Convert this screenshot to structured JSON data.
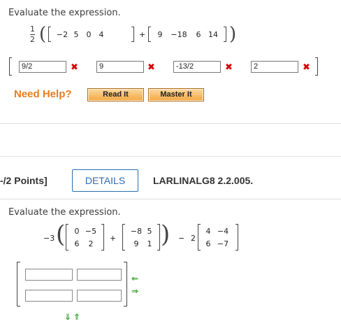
{
  "q1": {
    "prompt": "Evaluate the expression.",
    "fraction": {
      "num": "1",
      "den": "2"
    },
    "matrix_a": [
      "−2",
      "5",
      "0",
      "4"
    ],
    "plus": "+",
    "matrix_b": [
      "9",
      "−18",
      "6",
      "14"
    ],
    "answers": [
      "9/2",
      "9",
      "-13/2",
      "2"
    ],
    "wrong_mark": "✖",
    "need_help": "Need Help?",
    "read_it": "Read It",
    "master_it": "Master It"
  },
  "q2": {
    "points": "-/2 Points]",
    "details": "DETAILS",
    "code": "LARLINALG8 2.2.005.",
    "prompt": "Evaluate the expression.",
    "coef1": "−3",
    "m1": [
      [
        "0",
        "−5"
      ],
      [
        "6",
        "2"
      ]
    ],
    "plus": "+",
    "m2": [
      [
        "−8",
        "5"
      ],
      [
        "9",
        "1"
      ]
    ],
    "minus": "−",
    "coef2": "2",
    "m3": [
      [
        "4",
        "−4"
      ],
      [
        "6",
        "−7"
      ]
    ],
    "arrow_left": "⇐",
    "arrow_right": "⇒",
    "arrow_down": "⇓",
    "arrow_up": "⇑"
  },
  "colors": {
    "orange": "#e87c1e",
    "blue": "#2a6db0",
    "wrong": "#d00000",
    "arrow": "#2f9e2f"
  }
}
